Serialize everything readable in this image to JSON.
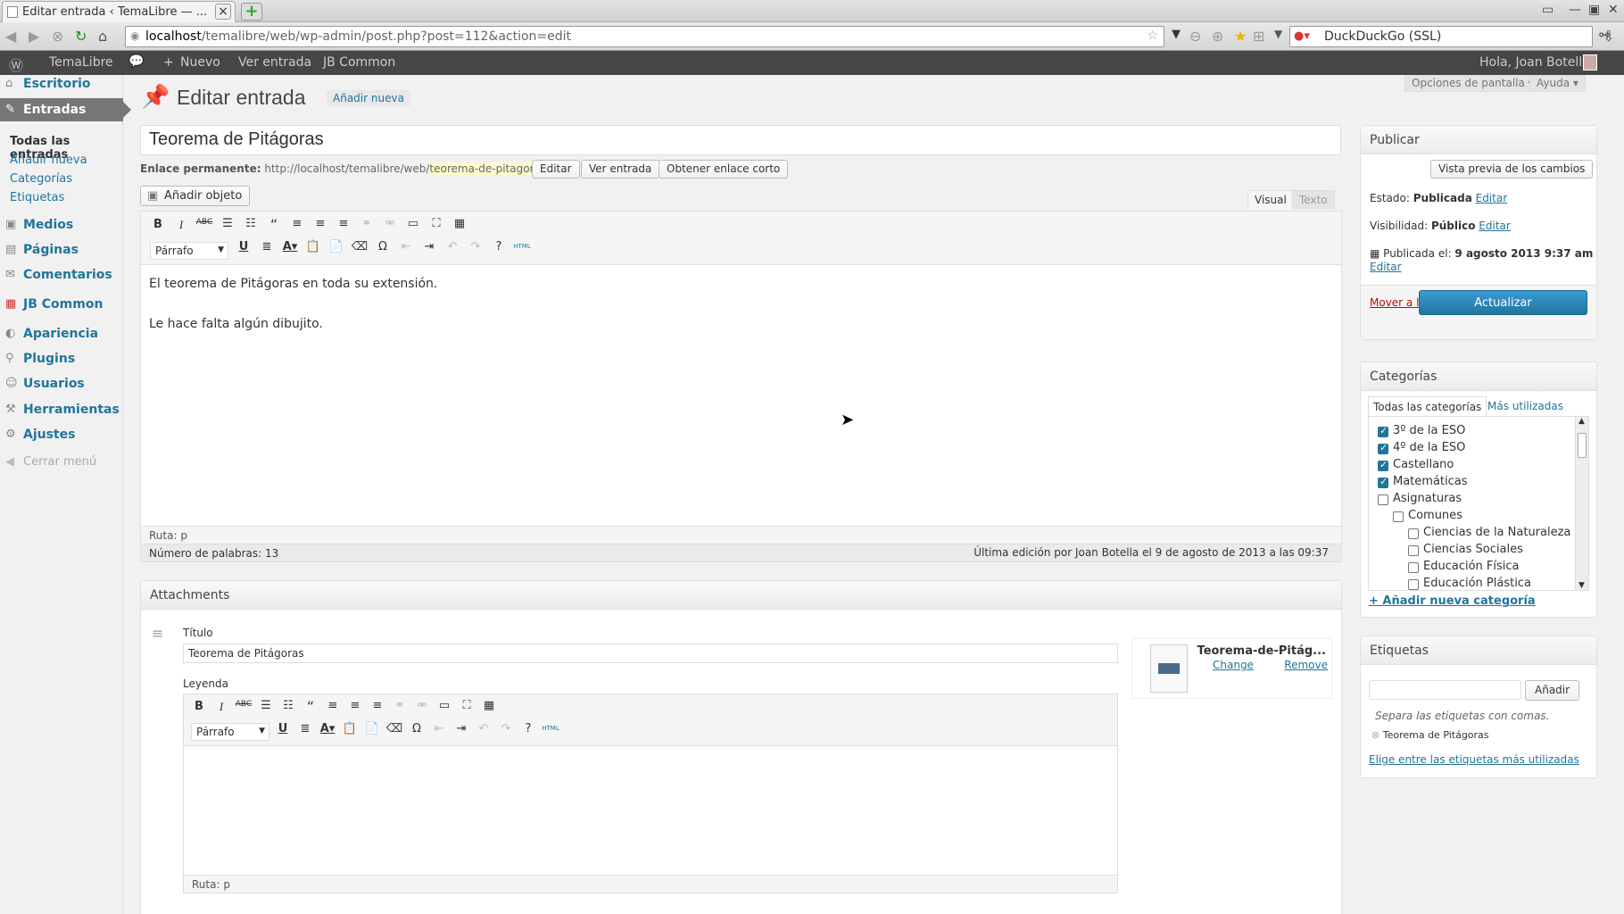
{
  "browser": {
    "tab_title": "Editar entrada ‹ TemaLibre — ...",
    "url_host": "localhost",
    "url_path": "/temalibre/web/wp-admin/post.php?post=112&action=edit",
    "search_engine": "DuckDuckGo (SSL)"
  },
  "adminbar": {
    "site": "TemaLibre",
    "new": "Nuevo",
    "view": "Ver entrada",
    "common": "JB Common",
    "greeting": "Hola, Joan Botella"
  },
  "sidebar": {
    "items": [
      {
        "label": "Escritorio",
        "icon": "⌂"
      },
      {
        "label": "Entradas",
        "icon": "✎"
      },
      {
        "label": "Medios",
        "icon": "▣"
      },
      {
        "label": "Páginas",
        "icon": "▤"
      },
      {
        "label": "Comentarios",
        "icon": "✉"
      },
      {
        "label": "JB Common",
        "icon": "▦"
      },
      {
        "label": "Apariencia",
        "icon": "◐"
      },
      {
        "label": "Plugins",
        "icon": "⚲"
      },
      {
        "label": "Usuarios",
        "icon": "☺"
      },
      {
        "label": "Herramientas",
        "icon": "⚒"
      },
      {
        "label": "Ajustes",
        "icon": "⚙"
      }
    ],
    "subitems": [
      "Todas las entradas",
      "Añadir nueva",
      "Categorías",
      "Etiquetas"
    ],
    "collapse": "Cerrar menú"
  },
  "header": {
    "title": "Editar entrada",
    "add_new": "Añadir nueva",
    "screen_options": "Opciones de pantalla ▾",
    "help": "Ayuda ▾"
  },
  "post": {
    "title": "Teorema de Pitágoras",
    "permalink_label": "Enlace permanente:",
    "permalink_base": "http://localhost/temalibre/web/",
    "permalink_slug": "teorema-de-pitagoras",
    "permalink_end": "/",
    "edit_btn": "Editar",
    "view_btn": "Ver entrada",
    "shortlink_btn": "Obtener enlace corto",
    "add_media": "Añadir objeto",
    "tab_visual": "Visual",
    "tab_text": "Texto",
    "format_select": "Párrafo",
    "content_line1": "El teorema de Pitágoras en toda su extensión.",
    "content_line2": "Le hace falta algún dibujito.",
    "path": "Ruta: p",
    "word_count": "Número de palabras: 13",
    "last_edit": "Última edición por Joan Botella el 9 de agosto de 2013 a las 09:37"
  },
  "attachments": {
    "heading": "Attachments",
    "title_label": "Título",
    "title_value": "Teorema de Pitágoras",
    "caption_label": "Leyenda",
    "file_name": "Teorema-de-Pitág...",
    "change": "Change",
    "remove": "Remove",
    "format_select": "Párrafo",
    "path": "Ruta: p"
  },
  "publish": {
    "heading": "Publicar",
    "preview": "Vista previa de los cambios",
    "status_label": "Estado:",
    "status_value": "Publicada",
    "visibility_label": "Visibilidad:",
    "visibility_value": "Público",
    "published_label": "Publicada el:",
    "published_value": "9 agosto 2013 9:37 am",
    "edit": "Editar",
    "trash": "Mover a la papelera",
    "update": "Actualizar"
  },
  "categories": {
    "heading": "Categorías",
    "tab_all": "Todas las categorías",
    "tab_popular": "Más utilizadas",
    "items": [
      {
        "label": "3º de la ESO",
        "checked": true,
        "level": 0
      },
      {
        "label": "4º de la ESO",
        "checked": true,
        "level": 0
      },
      {
        "label": "Castellano",
        "checked": true,
        "level": 0
      },
      {
        "label": "Matemáticas",
        "checked": true,
        "level": 0
      },
      {
        "label": "Asignaturas",
        "checked": false,
        "level": 0
      },
      {
        "label": "Comunes",
        "checked": false,
        "level": 1
      },
      {
        "label": "Ciencias de la Naturaleza",
        "checked": false,
        "level": 2
      },
      {
        "label": "Ciencias Sociales",
        "checked": false,
        "level": 2
      },
      {
        "label": "Educación Física",
        "checked": false,
        "level": 2
      },
      {
        "label": "Educación Plástica",
        "checked": false,
        "level": 2
      }
    ],
    "add_new": "+ Añadir nueva categoría"
  },
  "tags": {
    "heading": "Etiquetas",
    "add_btn": "Añadir",
    "hint": "Separa las etiquetas con comas.",
    "tag": "Teorema de Pitágoras",
    "choose": "Elige entre las etiquetas más utilizadas"
  },
  "colors": {
    "accent": "#21759b",
    "update_btn": "#2e8ec4",
    "trash": "#bc0b0b",
    "adminbar": "#464646"
  }
}
